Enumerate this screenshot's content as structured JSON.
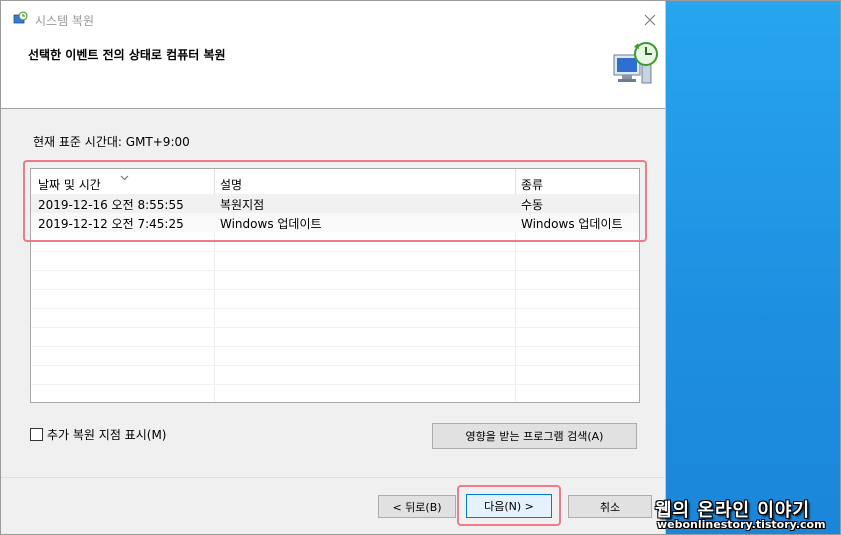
{
  "window": {
    "title": "시스템 복원"
  },
  "header": {
    "title": "선택한 이벤트 전의 상태로 컴퓨터 복원"
  },
  "timezone_label": "현재 표준 시간대: GMT+9:00",
  "table": {
    "columns": [
      "날짜 및 시간",
      "설명",
      "종류"
    ],
    "rows": [
      [
        "2019-12-16 오전 8:55:55",
        "복원지점",
        "수동"
      ],
      [
        "2019-12-12 오전 7:45:25",
        "Windows 업데이트",
        "Windows 업데이트"
      ]
    ]
  },
  "checkbox": {
    "label": "추가 복원 지점 표시(M)",
    "checked": false
  },
  "buttons": {
    "affected": "영향을 받는 프로그램 검색(A)",
    "back": "< 뒤로(B)",
    "next": "다음(N) >",
    "cancel": "취소"
  },
  "watermark": {
    "line1": "웹의 온라인 이야기",
    "line2": "webonlinestory.tistory.com"
  },
  "colors": {
    "highlight": "#ee7a8c",
    "accent": "#0078d7",
    "desktop": "#1e8fe0"
  },
  "icons": {
    "window": "system-restore-icon",
    "header": "computer-restore-icon",
    "close": "close-icon",
    "sort": "sort-chevron-icon"
  }
}
